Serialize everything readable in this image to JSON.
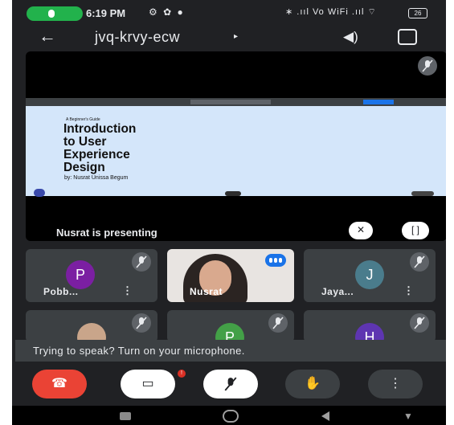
{
  "status_bar": {
    "time": "6:19 PM",
    "left_icons": "⚙ ✿ ●",
    "right_icons": "∗ .ııl Vo WiFi .ııl ⌔",
    "battery": "26"
  },
  "top_bar": {
    "meeting_code": "jvq-krvy-ecw",
    "caret": "▸"
  },
  "presentation": {
    "slide_guide": "A Beginner's Guide",
    "slide_title_line1": "Introduction",
    "slide_title_line2": "to User",
    "slide_title_line3": "Experience",
    "slide_title_line4": "Design",
    "slide_author": "by: Nusrat Unissa Begum",
    "presenting_label": "Nusrat is presenting"
  },
  "participants": [
    {
      "initial": "P",
      "name": "Pobb...",
      "color": "#7b1fa2"
    },
    {
      "name": "Nusrat"
    },
    {
      "initial": "J",
      "name": "Jaya...",
      "color": "#4a7c8c"
    },
    {
      "initial": "",
      "color": "#c9a58a"
    },
    {
      "initial": "P",
      "color": "#43a047"
    },
    {
      "initial": "H",
      "color": "#5e35b1"
    }
  ],
  "toast": {
    "message": "Trying to speak? Turn on your microphone."
  },
  "controls": {
    "camera_badge": "!"
  }
}
